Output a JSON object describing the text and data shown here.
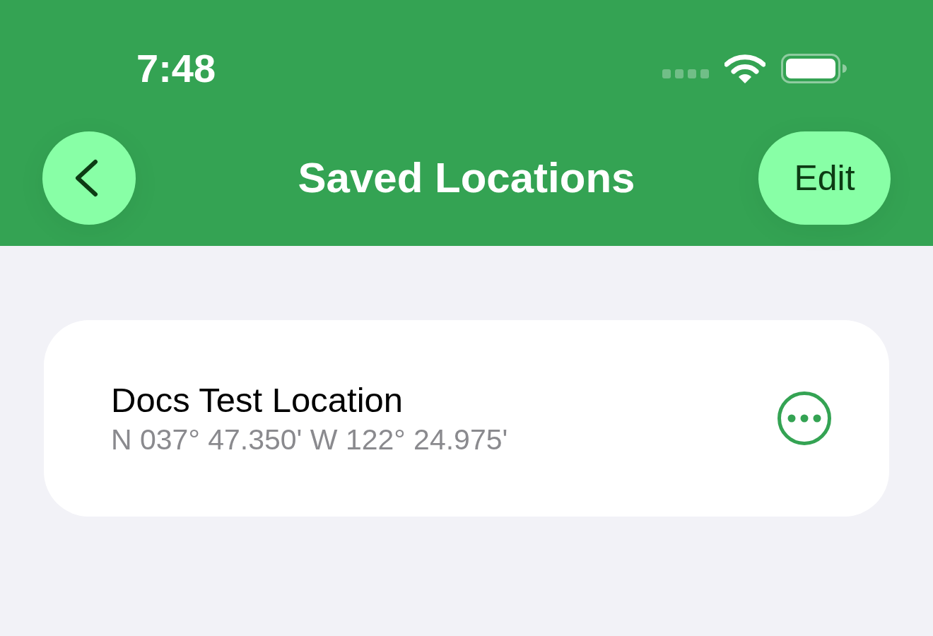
{
  "status_bar": {
    "time": "7:48"
  },
  "nav_bar": {
    "title": "Saved Locations",
    "edit_button": {
      "label": "Edit"
    }
  },
  "locations": [
    {
      "name": "Docs Test Location",
      "coordinates": "N 037° 47.350' W 122° 24.975'"
    }
  ]
}
